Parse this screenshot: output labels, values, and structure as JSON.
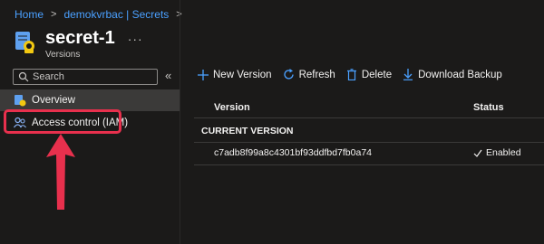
{
  "breadcrumb": {
    "items": [
      "Home",
      "demokvrbac | Secrets"
    ]
  },
  "header": {
    "title": "secret-1",
    "more_label": "···",
    "subtitle": "Versions"
  },
  "sidebar": {
    "search_placeholder": "Search",
    "collapse_label": "«",
    "items": [
      {
        "label": "Overview",
        "icon": "overview-icon"
      },
      {
        "label": "Access control (IAM)",
        "icon": "iam-users-icon"
      }
    ]
  },
  "toolbar": {
    "new_version": "New Version",
    "refresh": "Refresh",
    "delete": "Delete",
    "download_backup": "Download Backup"
  },
  "table": {
    "columns": [
      "Version",
      "Status"
    ],
    "group_label": "CURRENT VERSION",
    "rows": [
      {
        "version": "c7adb8f99a8c4301bf93ddfbd7fb0a74",
        "status": "Enabled"
      }
    ]
  },
  "colors": {
    "accent": "#4aa0ff",
    "highlight": "#e8304d",
    "background": "#1b1a19"
  }
}
